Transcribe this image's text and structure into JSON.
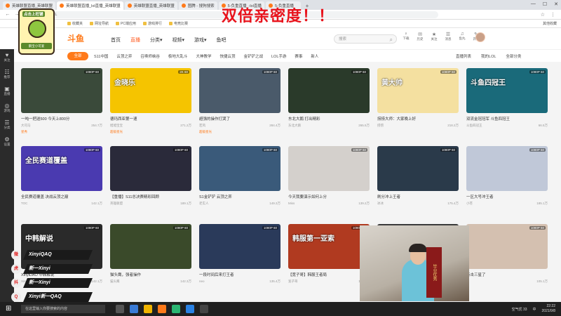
{
  "browser": {
    "tabs": [
      {
        "label": "英雄联盟直播_英雄联盟",
        "active": false
      },
      {
        "label": "英雄联盟直播_lol直播_英雄联盟",
        "active": true
      },
      {
        "label": "英雄联盟直播_英雄联盟",
        "active": false
      },
      {
        "label": "图腾 - 搜狗搜索",
        "active": false
      },
      {
        "label": "5-负重直播_-lol直播",
        "active": false
      },
      {
        "label": "5-负重直播",
        "active": false
      }
    ],
    "new_tab": "+",
    "url": "LOL",
    "bookmarks": [
      "收藏夹",
      "网址导航",
      "PC端应用",
      "游戏排行",
      "电竞比赛"
    ],
    "bookmarks_right": "其他收藏"
  },
  "overlay_title": "双倍亲密度！！",
  "pet_overlay": {
    "top_label": "点击上旺铺",
    "sign": "鹅宝小可爱"
  },
  "site": {
    "logo": "斗鱼",
    "nav": [
      {
        "label": "首页",
        "active": false
      },
      {
        "label": "直播",
        "active": true
      },
      {
        "label": "分类▾",
        "active": false
      },
      {
        "label": "视频▾",
        "active": false
      },
      {
        "label": "游戏▾",
        "active": false
      },
      {
        "label": "鱼吧",
        "active": false
      }
    ],
    "search_placeholder": "搜索",
    "header_icons": [
      {
        "glyph": "♀",
        "label": "下载"
      },
      {
        "glyph": "✉",
        "label": "历史"
      },
      {
        "glyph": "★",
        "label": "关注"
      },
      {
        "glyph": "☰",
        "label": "消息"
      },
      {
        "glyph": "♫",
        "label": "鱼丸"
      },
      {
        "glyph": "✎",
        "label": "开播"
      }
    ]
  },
  "categories": {
    "all": "全部",
    "items": [
      "S11中国",
      "云顶之弈",
      "召唤师峡谷",
      "极地大乱斗",
      "大神教学",
      "快捷云顶",
      "金铲铲之战",
      "LOL手游",
      "赛事",
      "新人"
    ],
    "right": [
      "直播列表",
      "我的LOL",
      "全部分类"
    ]
  },
  "sidebar": [
    {
      "glyph": "♥",
      "label": "关注"
    },
    {
      "glyph": "☷",
      "label": "推荐"
    },
    {
      "glyph": "▣",
      "label": "直播"
    },
    {
      "glyph": "◎",
      "label": "游戏"
    },
    {
      "glyph": "☰",
      "label": "分类"
    },
    {
      "glyph": "⚙",
      "label": "设置"
    }
  ],
  "cards": [
    {
      "title": "一吨一把送500 今天上800分",
      "streamer": "大司马",
      "viewers": "254.7万",
      "tag": "星秀",
      "thumb_text": "",
      "color": "#3a4a3a",
      "quality": "1080P 60"
    },
    {
      "title": "德玛西亚第一速",
      "streamer": "旭旭宝宝",
      "viewers": "271.2万",
      "tag": "超级星光",
      "thumb_text": "金晓乐",
      "color": "#f5c400",
      "quality": "2K 60"
    },
    {
      "title": "超强的操作打哭了",
      "streamer": "若风",
      "viewers": "284.4万",
      "tag": "超级星光",
      "thumb_text": "",
      "color": "#4a5a6a",
      "quality": "1080P 60"
    },
    {
      "title": "东北大鹅 打出精彩",
      "streamer": "东北大鹅",
      "viewers": "265.5万",
      "tag": "",
      "thumb_text": "",
      "color": "#2a3a2a",
      "quality": "1080P 60"
    },
    {
      "title": "捞捞大师：大家晚上好",
      "streamer": "捞捞",
      "viewers": "218.2万",
      "tag": "",
      "thumb_text": "黄大帅",
      "color": "#f4e0a0",
      "quality": "1080P 60"
    },
    {
      "title": "双流金冠冠军 斗鱼四冠王",
      "streamer": "斗鱼四冠王",
      "viewers": "66.5万",
      "tag": "",
      "thumb_text": "斗鱼四冠王",
      "color": "#1a6a7a",
      "quality": "1080P 60"
    },
    {
      "title": "全民赛道覆盖 决战云顶之巅",
      "streamer": "TOC",
      "viewers": "142.1万",
      "tag": "",
      "thumb_text": "全民赛道覆盖",
      "color": "#4a3ab0",
      "quality": "1080P 60"
    },
    {
      "title": "【重播】S11总决赛精彩回顾",
      "streamer": "英雄联盟",
      "viewers": "189.1万",
      "tag": "",
      "thumb_text": "",
      "color": "#2a2a3a",
      "quality": "1080P 60"
    },
    {
      "title": "S1金铲铲 云顶之弈",
      "streamer": "老实人",
      "viewers": "149.3万",
      "tag": "",
      "thumb_text": "",
      "color": "#3a5a7a",
      "quality": "1080P 60"
    },
    {
      "title": "今天我要演示如何上分",
      "streamer": "Miss",
      "viewers": "139.2万",
      "tag": "",
      "thumb_text": "",
      "color": "#d4d0cc",
      "quality": "1080P 60"
    },
    {
      "title": "刷分冲上王者",
      "streamer": "冰冰",
      "viewers": "175.4万",
      "tag": "",
      "thumb_text": "",
      "color": "#2a3a4a",
      "quality": "1080P 60"
    },
    {
      "title": "一区大号冲王者",
      "streamer": "小苍",
      "viewers": "185.1万",
      "tag": "",
      "thumb_text": "",
      "color": "#c0c8d8",
      "quality": "1080P 60"
    },
    {
      "title": "XinyiDAO 中韩解说",
      "streamer": "Xinyi",
      "viewers": "142.1万",
      "tag": "",
      "thumb_text": "中韩解说",
      "color": "#2a2a2a",
      "quality": "1080P 60"
    },
    {
      "title": "猫头鹰，强者操作",
      "streamer": "猫头鹰",
      "viewers": "142.3万",
      "tag": "",
      "thumb_text": "",
      "color": "#3a4a2a",
      "quality": "1080P 60"
    },
    {
      "title": "一段时间后来打王者",
      "streamer": "neo",
      "viewers": "135.4万",
      "tag": "",
      "thumb_text": "",
      "color": "#2a3a5a",
      "quality": "1080P 60"
    },
    {
      "title": "【宽子哥】韩服王者局",
      "streamer": "宽子哥",
      "viewers": "128.1万",
      "tag": "",
      "thumb_text": "韩服第一亚索",
      "color": "#b03a20",
      "quality": "1080P 60"
    },
    {
      "title": "",
      "streamer": "",
      "viewers": "",
      "tag": "",
      "thumb_text": "",
      "color": "#3a3a3a",
      "quality": "1080P 60"
    },
    {
      "title": "点击三星了",
      "streamer": "",
      "viewers": "105.1万",
      "tag": "",
      "thumb_text": "",
      "color": "#d4c0b0",
      "quality": "1080P 60"
    }
  ],
  "social": [
    {
      "platform": "weibo-icon",
      "glyph": "微",
      "name": "XinyiQAQ"
    },
    {
      "platform": "huya-icon",
      "glyph": "虎",
      "name": "新一Xinyi"
    },
    {
      "platform": "douyin-icon",
      "glyph": "抖",
      "name": "新一Xinyi"
    },
    {
      "platform": "qq-icon",
      "glyph": "Q",
      "name": "Xinyi新一QAQ"
    }
  ],
  "banner_text": "毕业优秀",
  "taskbar": {
    "search_placeholder": "在这里输入你要搜索的内容",
    "tray": [
      "中",
      "空气优 33"
    ],
    "time": "22:22",
    "date": "2021/9/8"
  }
}
